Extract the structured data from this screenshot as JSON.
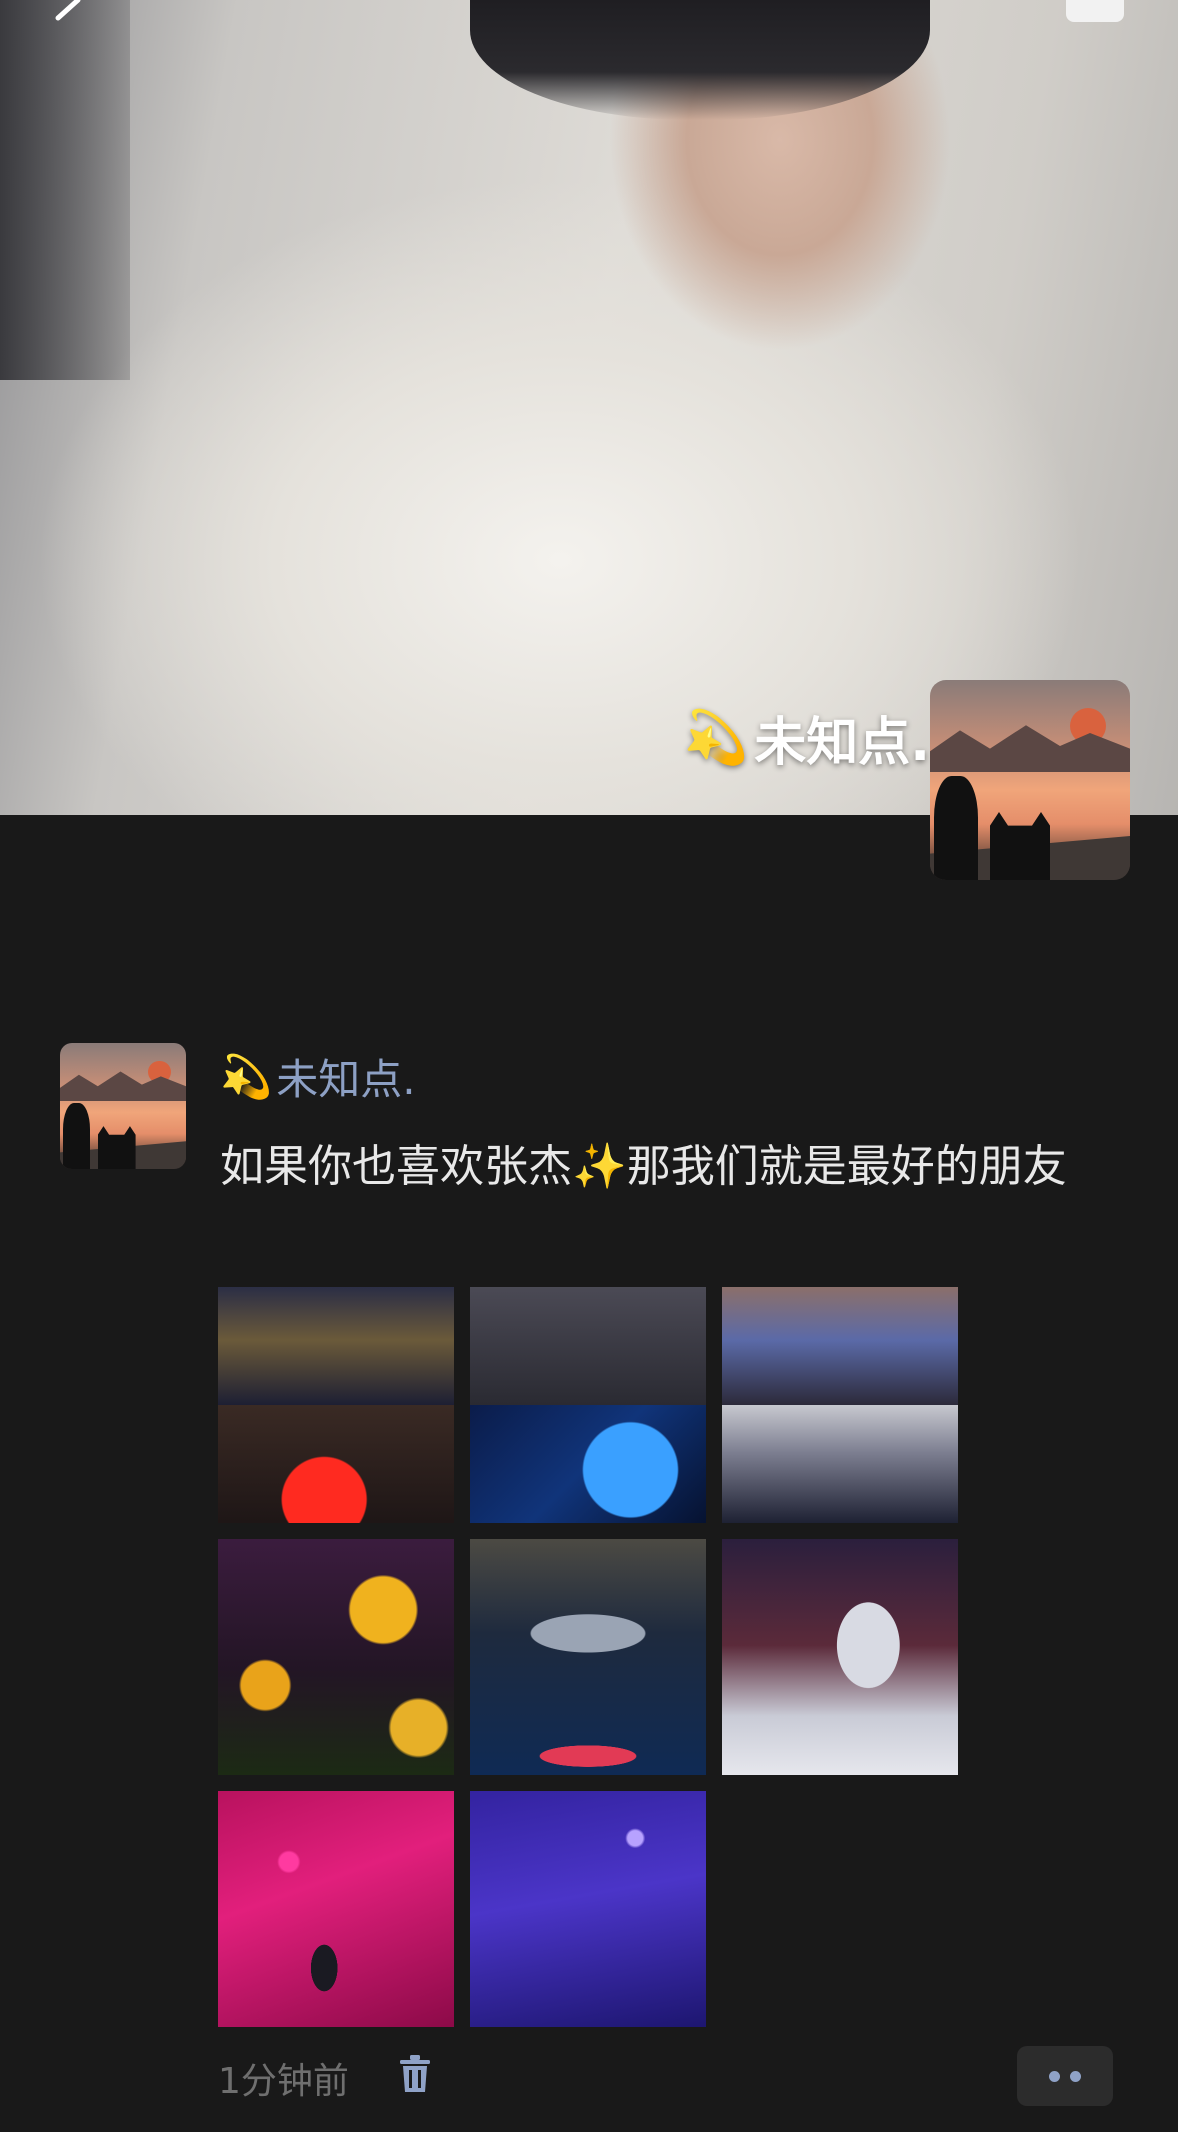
{
  "cover": {
    "name": "未知点.",
    "emoji": "💫"
  },
  "post": {
    "author": "未知点.",
    "author_emoji": "💫",
    "text_part1": "如果你也喜欢张杰",
    "text_emoji": "✨",
    "text_part2": "那我们就是最好的朋友",
    "photos": [
      {
        "label": "photo-1"
      },
      {
        "label": "photo-2"
      },
      {
        "label": "photo-3"
      },
      {
        "label": "photo-4"
      },
      {
        "label": "photo-5"
      },
      {
        "label": "photo-6"
      },
      {
        "label": "photo-7"
      },
      {
        "label": "photo-8"
      }
    ],
    "time": "1分钟前"
  },
  "icons": {
    "delete": "trash-icon",
    "more": "more-options-icon",
    "back": "back-icon",
    "camera": "camera-icon"
  },
  "colors": {
    "background": "#191919",
    "name_link": "#8da0c4",
    "body_text": "#e8e8e8",
    "timestamp": "#6f6f6f"
  }
}
